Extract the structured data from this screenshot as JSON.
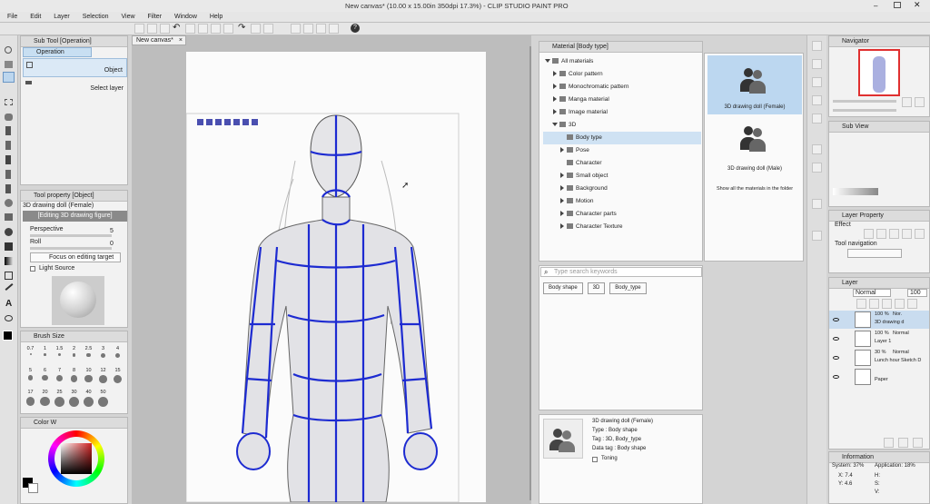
{
  "app": {
    "title": "New canvas* (10.00 x 15.00in 350dpi 17.3%) - CLIP STUDIO PAINT PRO",
    "menu": [
      "File",
      "Edit",
      "Layer",
      "Selection",
      "View",
      "Filter",
      "Window",
      "Help"
    ],
    "canvas_tab": "New canvas*"
  },
  "subtool": {
    "title": "Sub Tool [Operation]",
    "tab": "Operation",
    "items": [
      "Object",
      "Select layer"
    ]
  },
  "tool_property": {
    "title": "Tool property [Object]",
    "selected": "3D drawing doll (Female)",
    "editing": "[Editing 3D drawing figure]",
    "perspective_label": "Perspective",
    "perspective_value": "5",
    "roll_label": "Roll",
    "roll_value": "0",
    "focus_button": "Focus on editing target",
    "light_source": "Light Source"
  },
  "brush_size": {
    "title": "Brush Size",
    "values": [
      "0.7",
      "1",
      "1.5",
      "2",
      "2.5",
      "3",
      "4",
      "5",
      "6",
      "7",
      "8",
      "10",
      "12",
      "15",
      "17",
      "20",
      "25",
      "30",
      "40",
      "50"
    ]
  },
  "color": {
    "title": "Color W",
    "accent": "#d22222"
  },
  "material": {
    "title": "Material [Body type]",
    "tree": [
      {
        "label": "All materials",
        "level": 0,
        "expand": "down"
      },
      {
        "label": "Color pattern",
        "level": 1,
        "expand": "right"
      },
      {
        "label": "Monochromatic pattern",
        "level": 1,
        "expand": "right"
      },
      {
        "label": "Manga material",
        "level": 1,
        "expand": "right"
      },
      {
        "label": "Image material",
        "level": 1,
        "expand": "right"
      },
      {
        "label": "3D",
        "level": 1,
        "expand": "down"
      },
      {
        "label": "Body type",
        "level": 2,
        "expand": "none",
        "selected": true
      },
      {
        "label": "Pose",
        "level": 2,
        "expand": "right"
      },
      {
        "label": "Character",
        "level": 2,
        "expand": "none"
      },
      {
        "label": "Small object",
        "level": 2,
        "expand": "right"
      },
      {
        "label": "Background",
        "level": 2,
        "expand": "right"
      },
      {
        "label": "Motion",
        "level": 2,
        "expand": "right"
      },
      {
        "label": "Character parts",
        "level": 2,
        "expand": "right"
      },
      {
        "label": "Character Texture",
        "level": 2,
        "expand": "right"
      }
    ],
    "items": [
      "3D drawing doll (Female)",
      "3D drawing doll (Male)"
    ],
    "show_all": "Show all the materials in the folder",
    "search_placeholder": "Type search keywords",
    "tags": [
      "Body shape",
      "3D",
      "Body_type"
    ],
    "detail": {
      "name": "3D drawing doll (Female)",
      "type": "Type : Body shape",
      "tag": "Tag : 3D, Body_type",
      "data_tag": "Data tag : Body shape",
      "toning": "Toning"
    }
  },
  "navigator": {
    "title": "Navigator"
  },
  "subview": {
    "title": "Sub View"
  },
  "layer_property": {
    "title": "Layer Property",
    "effect": "Effect",
    "tool_navigation": "Tool navigation"
  },
  "layer": {
    "title": "Layer",
    "blend": "Normal",
    "opacity": "100",
    "layers": [
      {
        "pct": "100 %",
        "mode": "Nor.",
        "name": "3D drawing d"
      },
      {
        "pct": "100 %",
        "mode": "Normal",
        "name": "Layer 1"
      },
      {
        "pct": "30 %",
        "mode": "Normal",
        "name": "Lunch hour Sketch D"
      },
      {
        "pct": "",
        "mode": "",
        "name": "Paper"
      }
    ]
  },
  "info": {
    "title": "Information",
    "system": "System: 37%",
    "application": "Application: 18%",
    "x": "X: 7.4",
    "y": "Y: 4.6",
    "h": "H:",
    "v": "V:",
    "s": "S:"
  }
}
